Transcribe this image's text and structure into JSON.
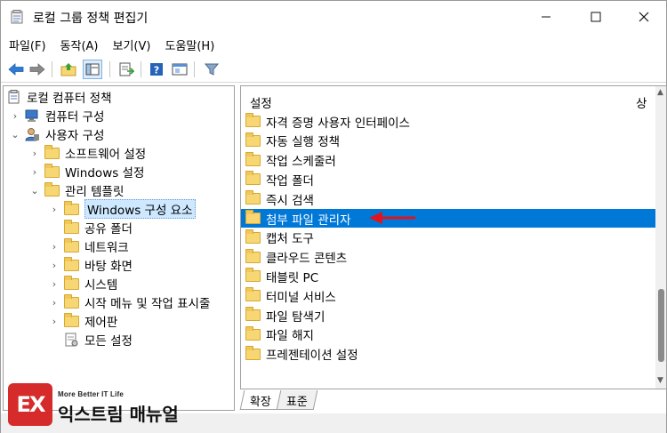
{
  "window": {
    "title": "로컬 그룹 정책 편집기",
    "minimize": "—",
    "maximize": "☐",
    "close": "✕"
  },
  "menu": [
    "파일(F)",
    "동작(A)",
    "보기(V)",
    "도움말(H)"
  ],
  "toolbar": {
    "icons": [
      "back-arrow-icon",
      "forward-arrow-icon",
      "up-folder-icon",
      "show-hide-tree-icon",
      "export-list-icon",
      "help-icon",
      "properties-icon",
      "filter-icon"
    ]
  },
  "tree": [
    {
      "label": "로컬 컴퓨터 정책",
      "level": 0,
      "chevron": "",
      "icon": "policy-icon"
    },
    {
      "label": "컴퓨터 구성",
      "level": 1,
      "chevron": "›",
      "icon": "computer-icon"
    },
    {
      "label": "사용자 구성",
      "level": 1,
      "chevron": "⌄",
      "icon": "user-icon"
    },
    {
      "label": "소프트웨어 설정",
      "level": 2,
      "chevron": "›",
      "icon": "folder-icon"
    },
    {
      "label": "Windows 설정",
      "level": 2,
      "chevron": "›",
      "icon": "folder-icon"
    },
    {
      "label": "관리 템플릿",
      "level": 2,
      "chevron": "⌄",
      "icon": "folder-icon"
    },
    {
      "label": "Windows 구성 요소",
      "level": 3,
      "chevron": "›",
      "icon": "folder-icon",
      "selected": true
    },
    {
      "label": "공유 폴더",
      "level": 3,
      "chevron": "",
      "icon": "folder-icon"
    },
    {
      "label": "네트워크",
      "level": 3,
      "chevron": "›",
      "icon": "folder-icon"
    },
    {
      "label": "바탕 화면",
      "level": 3,
      "chevron": "›",
      "icon": "folder-icon"
    },
    {
      "label": "시스템",
      "level": 3,
      "chevron": "›",
      "icon": "folder-icon"
    },
    {
      "label": "시작 메뉴 및 작업 표시줄",
      "level": 3,
      "chevron": "›",
      "icon": "folder-icon"
    },
    {
      "label": "제어판",
      "level": 3,
      "chevron": "›",
      "icon": "folder-icon"
    },
    {
      "label": "모든 설정",
      "level": 3,
      "chevron": "",
      "icon": "all-settings-icon"
    }
  ],
  "list": {
    "col_settings": "설정",
    "col_state": "상",
    "items": [
      "자격 증명 사용자 인터페이스",
      "자동 실행 정책",
      "작업 스케줄러",
      "작업 폴더",
      "즉시 검색",
      "첨부 파일 관리자",
      "캡처 도구",
      "클라우드 콘텐츠",
      "태블릿 PC",
      "터미널 서비스",
      "파일 탐색기",
      "파일 해지",
      "프레젠테이션 설정"
    ],
    "selected_index": 5
  },
  "tabs": [
    "확장",
    "표준"
  ],
  "watermark": {
    "tagline": "More Better IT Life",
    "name": "익스트림 매뉴얼",
    "logo_text": "EX"
  },
  "colors": {
    "selection": "#0078d7",
    "arrow": "#e0141e",
    "logo": "#d62b2b"
  }
}
